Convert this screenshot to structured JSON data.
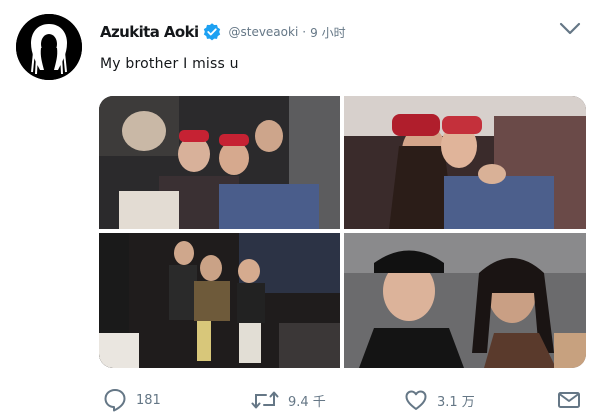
{
  "tweet": {
    "display_name": "Azukita Aoki",
    "handle": "@steveaoki",
    "separator": "·",
    "time": "9 小时",
    "text": "My brother I miss u",
    "verified": true,
    "photos": [
      {
        "alt_icon": "photo-icon"
      },
      {
        "alt_icon": "photo-icon"
      },
      {
        "alt_icon": "photo-icon"
      },
      {
        "alt_icon": "photo-icon"
      }
    ],
    "actions": {
      "reply_count": "181",
      "retweet_count": "9.4 千",
      "like_count": "3.1 万"
    }
  },
  "colors": {
    "text": "#14171a",
    "secondary": "#657786",
    "verified": "#1da1f2"
  }
}
